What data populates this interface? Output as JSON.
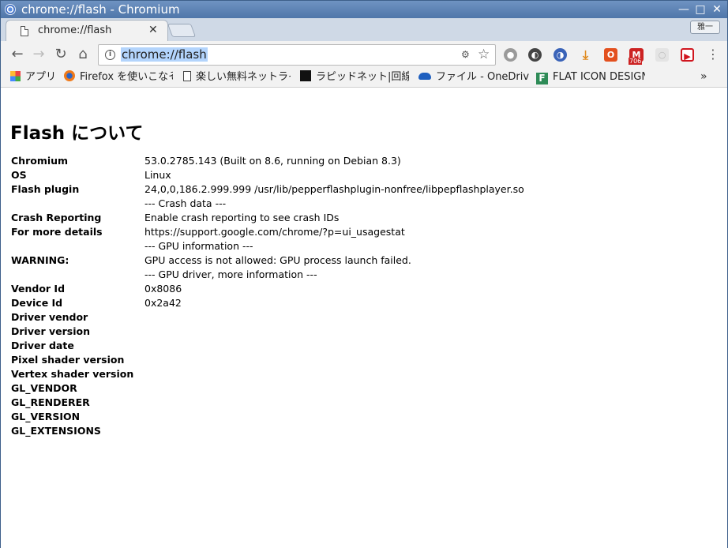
{
  "window": {
    "title": "chrome://flash - Chromium"
  },
  "tab": {
    "title": "chrome://flash"
  },
  "profile": {
    "label": "雅一"
  },
  "omnibox": {
    "url": "chrome://flash"
  },
  "bookmarks": [
    {
      "label": "アプリ",
      "icon": "apps-grid-icon"
    },
    {
      "label": "Firefox を使いこなそ",
      "icon": "firefox-icon"
    },
    {
      "label": "楽しい無料ネットライ",
      "icon": "page-icon"
    },
    {
      "label": "ラピッドネット|回線速",
      "icon": "rapidnet-icon"
    },
    {
      "label": "ファイル - OneDrive",
      "icon": "onedrive-cloud-icon"
    },
    {
      "label": "FLAT ICON DESIGN",
      "icon": "flat-icon-design-icon"
    }
  ],
  "extensions": {
    "gmail_badge": "706"
  },
  "page": {
    "heading": "Flash について",
    "rows": [
      {
        "key": "Chromium",
        "value": "53.0.2785.143 (Built on 8.6, running on Debian 8.3)"
      },
      {
        "key": "OS",
        "value": "Linux"
      },
      {
        "key": "Flash plugin",
        "value": "24,0,0,186.2.999.999 /usr/lib/pepperflashplugin-nonfree/libpepflashplayer.so"
      },
      {
        "key": "",
        "value": "--- Crash data ---"
      },
      {
        "key": "Crash Reporting",
        "value": "Enable crash reporting to see crash IDs"
      },
      {
        "key": "For more details",
        "value": "https://support.google.com/chrome/?p=ui_usagestat"
      },
      {
        "key": "",
        "value": "--- GPU information ---"
      },
      {
        "key": "WARNING:",
        "value": "GPU access is not allowed: GPU process launch failed."
      },
      {
        "key": "",
        "value": "--- GPU driver, more information ---"
      },
      {
        "key": "Vendor Id",
        "value": "0x8086"
      },
      {
        "key": "Device Id",
        "value": "0x2a42"
      },
      {
        "key": "Driver vendor",
        "value": ""
      },
      {
        "key": "Driver version",
        "value": ""
      },
      {
        "key": "Driver date",
        "value": ""
      },
      {
        "key": "Pixel shader version",
        "value": ""
      },
      {
        "key": "Vertex shader version",
        "value": ""
      },
      {
        "key": "GL_VENDOR",
        "value": ""
      },
      {
        "key": "GL_RENDERER",
        "value": ""
      },
      {
        "key": "GL_VERSION",
        "value": ""
      },
      {
        "key": "GL_EXTENSIONS",
        "value": ""
      }
    ]
  }
}
